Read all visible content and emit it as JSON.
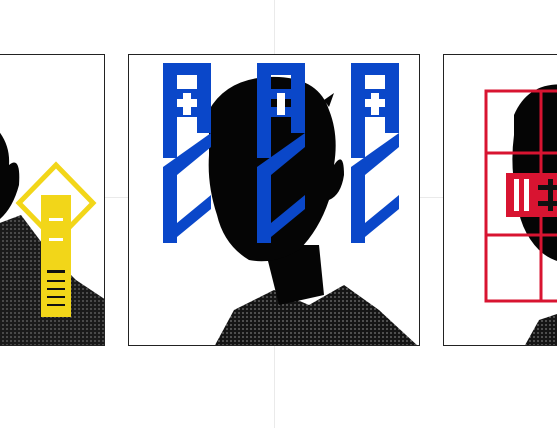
{
  "scene": {
    "description_free": true,
    "panels": [
      {
        "id": "left",
        "overlay_color": "#f2d619",
        "overlay_icon": "yellow-glyph-overlay"
      },
      {
        "id": "mid",
        "overlay_color": "#0a47c9",
        "overlay_icon": "blue-glyph-overlay"
      },
      {
        "id": "right",
        "overlay_color": "#d81431",
        "overlay_icon": "red-glyph-overlay"
      }
    ],
    "colors": {
      "silhouette": "#050505",
      "halftone": "#2a2a2a",
      "yellow": "#f2d619",
      "blue": "#0a47c9",
      "red": "#d81431",
      "frame": "#222222"
    }
  }
}
